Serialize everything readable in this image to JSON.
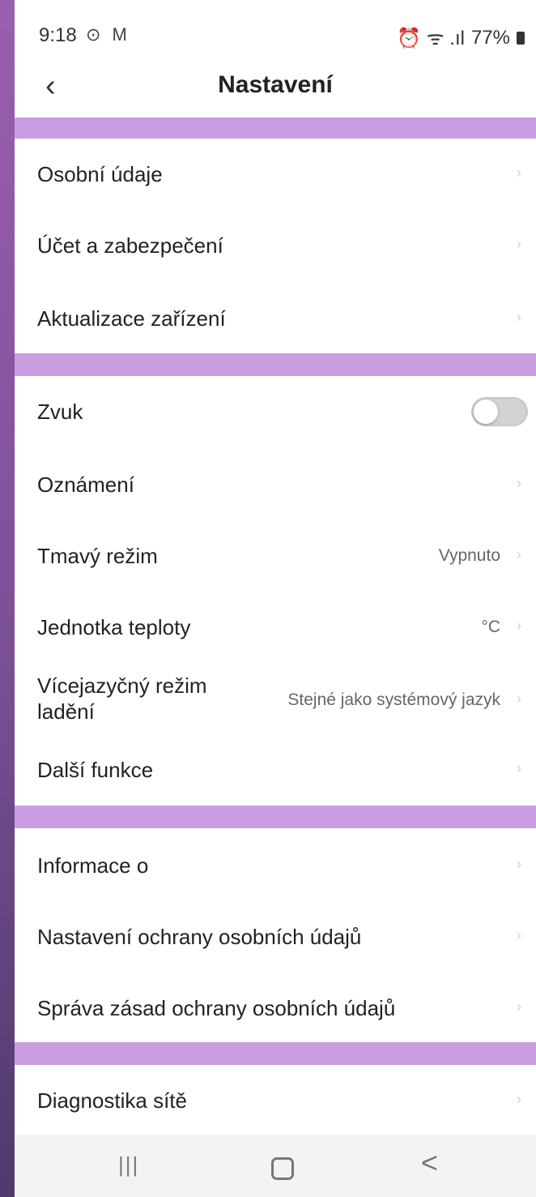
{
  "status_bar": {
    "time": "9:18",
    "icons": "⊙ M",
    "right_icons": "⏰ ᯤ .ıl",
    "battery": "77%"
  },
  "header": {
    "back_icon": "‹",
    "title": "Nastavení"
  },
  "sections": [
    {
      "items": [
        {
          "label": "Osobní údaje"
        },
        {
          "label": "Účet a zabezpečení"
        },
        {
          "label": "Aktualizace zařízení"
        }
      ]
    },
    {
      "items": [
        {
          "label": "Zvuk",
          "toggle": false
        },
        {
          "label": "Oznámení"
        },
        {
          "label": "Tmavý režim",
          "value": "Vypnuto"
        },
        {
          "label": "Jednotka teploty",
          "value": "°C"
        },
        {
          "label": "Vícejazyčný režim ladění",
          "value": "Stejné jako systémový jazyk"
        },
        {
          "label": "Další funkce"
        }
      ]
    },
    {
      "items": [
        {
          "label": "Informace o"
        },
        {
          "label": "Nastavení ochrany osobních údajů"
        },
        {
          "label": "Správa zásad ochrany osobních údajů"
        }
      ]
    },
    {
      "items": [
        {
          "label": "Diagnostika sítě"
        }
      ]
    }
  ],
  "nav_bar": {
    "recents_icon": "|||",
    "back_icon": "<"
  },
  "chevron_icon": "›",
  "colors": {
    "separator": "#c99de0",
    "background": "#ffffff",
    "toggle_off": "#d3d3d3"
  }
}
